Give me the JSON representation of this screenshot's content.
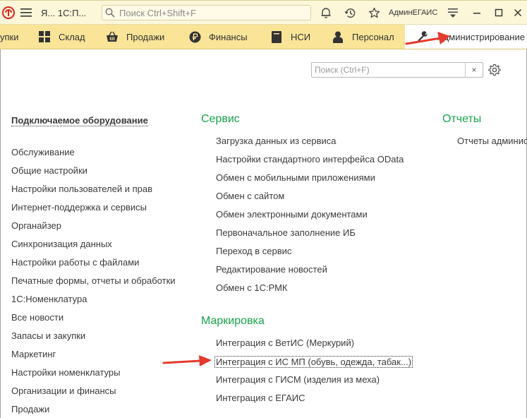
{
  "titlebar": {
    "app_title": "Я... 1С:П...",
    "search_placeholder": "Поиск Ctrl+Shift+F",
    "user": "АдминЕГАИС"
  },
  "sections": [
    {
      "label": "упки",
      "icon": "cart-icon"
    },
    {
      "label": "Склад",
      "icon": "warehouse-grid-icon"
    },
    {
      "label": "Продажи",
      "icon": "basket-icon"
    },
    {
      "label": "Финансы",
      "icon": "ruble-coin-icon"
    },
    {
      "label": "НСИ",
      "icon": "book-icon"
    },
    {
      "label": "Персонал",
      "icon": "person-icon"
    },
    {
      "label": "Администрирование",
      "icon": "gear-icon"
    }
  ],
  "panel": {
    "search_placeholder": "Поиск (Ctrl+F)",
    "clear_label": "×"
  },
  "left_links": [
    "Подключаемое оборудование",
    "Обслуживание",
    "Общие настройки",
    "Настройки пользователей и прав",
    "Интернет-поддержка и сервисы",
    "Органайзер",
    "Синхронизация данных",
    "Настройки работы с файлами",
    "Печатные формы, отчеты и обработки",
    "1С:Номенклатура",
    "Все новости",
    "Запасы и закупки",
    "Маркетинг",
    "Настройки номенклатуры",
    "Организации и финансы",
    "Продажи"
  ],
  "service": {
    "title": "Сервис",
    "items": [
      "Загрузка данных из сервиса",
      "Настройки стандартного интерфейса OData",
      "Обмен с мобильными приложениями",
      "Обмен с сайтом",
      "Обмен электронными документами",
      "Первоначальное заполнение ИБ",
      "Переход в сервис",
      "Редактирование новостей",
      "Обмен с 1С:РМК"
    ]
  },
  "marking": {
    "title": "Маркировка",
    "items": [
      "Интеграция с ВетИС (Меркурий)",
      "Интеграция с ИС МП (обувь, одежда, табак...)",
      "Интеграция с ГИСМ (изделия из меха)",
      "Интеграция с ЕГАИС"
    ]
  },
  "reports": {
    "title": "Отчеты",
    "items": [
      "Отчеты админис"
    ]
  },
  "colors": {
    "titlebar_bg": "#fcf7d9",
    "sectionbar_bg": "#f9e498",
    "group_title": "#17a34a",
    "annotation_arrow": "#e53a2f",
    "logo_red": "#d7261e"
  }
}
